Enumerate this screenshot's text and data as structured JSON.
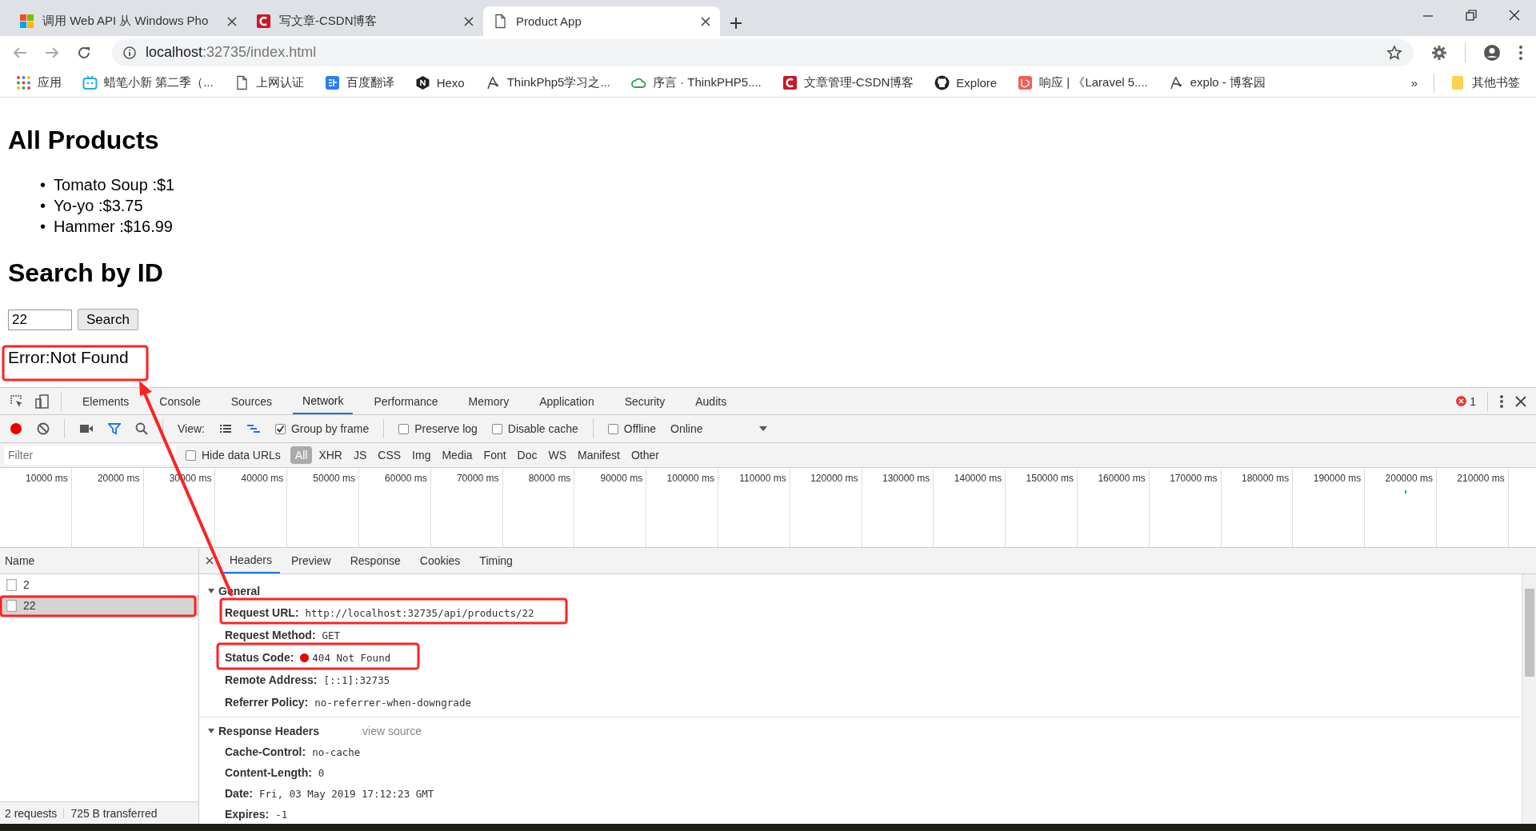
{
  "browser": {
    "tabs": [
      {
        "title": "调用 Web API 从 Windows Pho",
        "kind": "windows",
        "selected": false
      },
      {
        "title": "写文章-CSDN博客",
        "kind": "csdn",
        "selected": false
      },
      {
        "title": "Product App",
        "kind": "page",
        "selected": true
      }
    ],
    "address": {
      "host": "localhost",
      "path": ":32735/index.html"
    },
    "bookmarks": [
      {
        "label": "应用",
        "kind": "apps"
      },
      {
        "label": "蜡笔小新 第二季（...",
        "kind": "tv"
      },
      {
        "label": "上网认证",
        "kind": "page"
      },
      {
        "label": "百度翻译",
        "kind": "translate"
      },
      {
        "label": "Hexo",
        "kind": "hexo"
      },
      {
        "label": "ThinkPhp5学习之...",
        "kind": "sketch"
      },
      {
        "label": "序言 · ThinkPHP5....",
        "kind": "cloud"
      },
      {
        "label": "文章管理-CSDN博客",
        "kind": "csdn"
      },
      {
        "label": "Explore",
        "kind": "github"
      },
      {
        "label": "响应 | 《Laravel 5....",
        "kind": "laravel"
      },
      {
        "label": "explo - 博客园",
        "kind": "sketch"
      }
    ],
    "overflow": "»",
    "other_bookmarks": {
      "label": "其他书签",
      "kind": "folder"
    }
  },
  "page": {
    "heading": "All Products",
    "bullet": "•",
    "products": [
      "Tomato Soup :$1",
      "Yo-yo :$3.75",
      "Hammer :$16.99"
    ],
    "search_heading": "Search by ID",
    "search_value": "22",
    "search_button": "Search",
    "error": "Error:Not Found"
  },
  "devtools": {
    "tabs": [
      {
        "label": "Elements",
        "selected": false
      },
      {
        "label": "Console",
        "selected": false
      },
      {
        "label": "Sources",
        "selected": false
      },
      {
        "label": "Network",
        "selected": true
      },
      {
        "label": "Performance",
        "selected": false
      },
      {
        "label": "Memory",
        "selected": false
      },
      {
        "label": "Application",
        "selected": false
      },
      {
        "label": "Security",
        "selected": false
      },
      {
        "label": "Audits",
        "selected": false
      }
    ],
    "error_count": "1",
    "toolbar": {
      "recording": true,
      "view_label": "View:",
      "options": [
        {
          "label": "Group by frame",
          "checked": true
        },
        {
          "label": "Preserve log",
          "checked": false
        },
        {
          "label": "Disable cache",
          "checked": false
        },
        {
          "label": "Offline",
          "checked": false
        }
      ],
      "throttling": "Online"
    },
    "filter": {
      "placeholder": "Filter",
      "hide_data_urls": {
        "label": "Hide data URLs",
        "checked": false
      },
      "types": [
        {
          "label": "All",
          "selected": true
        },
        {
          "label": "XHR",
          "selected": false
        },
        {
          "label": "JS",
          "selected": false
        },
        {
          "label": "CSS",
          "selected": false
        },
        {
          "label": "Img",
          "selected": false
        },
        {
          "label": "Media",
          "selected": false
        },
        {
          "label": "Font",
          "selected": false
        },
        {
          "label": "Doc",
          "selected": false
        },
        {
          "label": "WS",
          "selected": false
        },
        {
          "label": "Manifest",
          "selected": false
        },
        {
          "label": "Other",
          "selected": false
        }
      ]
    },
    "timeline": {
      "ticks": [
        "10000 ms",
        "20000 ms",
        "30000 ms",
        "40000 ms",
        "50000 ms",
        "60000 ms",
        "70000 ms",
        "80000 ms",
        "90000 ms",
        "100000 ms",
        "110000 ms",
        "120000 ms",
        "130000 ms",
        "140000 ms",
        "150000 ms",
        "160000 ms",
        "170000 ms",
        "180000 ms",
        "190000 ms",
        "200000 ms",
        "210000 ms"
      ]
    },
    "requests": {
      "column": "Name",
      "rows": [
        {
          "name": "2",
          "selected": false
        },
        {
          "name": "22",
          "selected": true
        }
      ]
    },
    "detail_tabs": [
      {
        "label": "Headers",
        "selected": true
      },
      {
        "label": "Preview",
        "selected": false
      },
      {
        "label": "Response",
        "selected": false
      },
      {
        "label": "Cookies",
        "selected": false
      },
      {
        "label": "Timing",
        "selected": false
      }
    ],
    "sections": [
      {
        "title": "General",
        "expanded": true,
        "fields": [
          {
            "key": "Request URL:",
            "value": "http://localhost:32735/api/products/22",
            "kind": "plain"
          },
          {
            "key": "Request Method:",
            "value": "GET",
            "kind": "plain"
          },
          {
            "key": "Status Code:",
            "value": "404 Not Found",
            "kind": "status"
          },
          {
            "key": "Remote Address:",
            "value": "[::1]:32735",
            "kind": "plain"
          },
          {
            "key": "Referrer Policy:",
            "value": "no-referrer-when-downgrade",
            "kind": "plain"
          }
        ]
      },
      {
        "title": "Response Headers",
        "expanded": true,
        "link": "view source",
        "fields": [
          {
            "key": "Cache-Control:",
            "value": "no-cache",
            "kind": "plain"
          },
          {
            "key": "Content-Length:",
            "value": "0",
            "kind": "plain"
          },
          {
            "key": "Date:",
            "value": "Fri, 03 May 2019 17:12:23 GMT",
            "kind": "plain"
          },
          {
            "key": "Expires:",
            "value": "-1",
            "kind": "plain"
          }
        ]
      }
    ],
    "status": {
      "requests": "2 requests",
      "transferred": "725 B transferred"
    }
  }
}
